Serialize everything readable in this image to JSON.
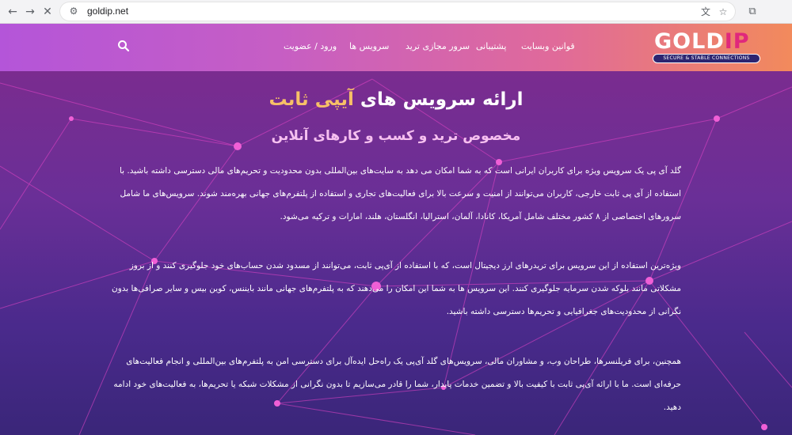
{
  "browser": {
    "url": "goldip.net",
    "back_icon": "arrow-left-icon",
    "forward_icon": "arrow-right-icon",
    "stop_icon": "close-icon"
  },
  "header": {
    "logo": {
      "word_main": "GOLD",
      "word_accent": "IP",
      "tagline": "SECURE & STABLE CONNECTIONS"
    },
    "menu": [
      "قوانین وبسایت",
      "پشتیبانی",
      "سرور مجازی ترید",
      "سرویس ها",
      "ورود / عضویت"
    ],
    "search_icon": "search-icon"
  },
  "hero": {
    "title_pre": "ارائه سرویس های",
    "title_highlight": "آیپی ثابت",
    "subtitle": "مخصوص ترید و کسب و کارهای آنلاین",
    "paragraphs": [
      "گلد آی پی یک سرویس ویژه برای کاربران ایرانی است که به شما امکان می دهد به سایت‌های بین‌المللی بدون محدودیت و تحریم‌های مالی دسترسی داشته باشید. با استفاده از آی پی ثابت خارجی، کاربران می‌توانند از امنیت و سرعت بالا برای فعالیت‌های تجاری و استفاده از پلتفرم‌های جهانی بهره‌مند شوند. سرویس‌های ما شامل سرورهای اختصاصی از ۸ کشور مختلف شامل آمریکا، کانادا، آلمان، استرالیا، انگلستان، هلند، امارات و ترکیه می‌شود.",
      "ویژه‌ترین استفاده از این سرویس برای تریدرهای ارز دیجیتال است، که با استفاده از آی‌پی ثابت، می‌توانند از مسدود شدن حساب‌های خود جلوگیری کنند و از بروز مشکلاتی مانند بلوکه شدن سرمایه جلوگیری کنند. این سرویس ها به شما این امکان را می‌دهند که به پلتفرم‌های جهانی مانند بایننس، کوین بیس و سایر صرافی‌ها بدون نگرانی از محدودیت‌های جغرافیایی و تحریم‌ها دسترسی داشته باشید.",
      "همچنین، برای فریلنسرها، طراحان وب، و مشاوران مالی، سرویس‌های گلد آی‌پی یک راه‌حل ایده‌آل برای دسترسی امن به پلتفرم‌های بین‌المللی و انجام فعالیت‌های حرفه‌ای است. ما با ارائه آی‌پی ثابت با کیفیت بالا و تضمین خدمات پایدار، شما را قادر می‌سازیم تا بدون نگرانی از مشکلات شبکه یا تحریم‌ها، به فعالیت‌های خود ادامه دهید."
    ]
  }
}
